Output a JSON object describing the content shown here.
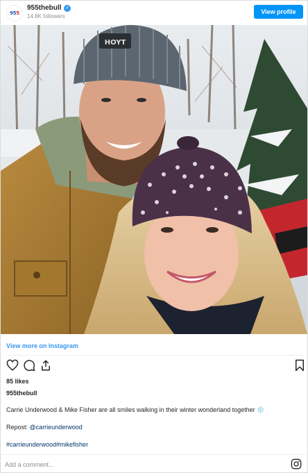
{
  "header": {
    "username": "955thebull",
    "followers": "14.8K followers",
    "view_profile_label": "View profile",
    "avatar_logo_main": "95",
    "avatar_logo_accent": "5"
  },
  "post": {
    "view_more_label": "View more on Instagram",
    "likes": "85 likes",
    "caption_user": "955thebull",
    "caption_text": "Carrie Underwood & Mike Fisher are all smiles walking in their winter wonderland together",
    "caption_emoji": "❄️",
    "repost_prefix": "Repost:",
    "repost_mention": "@carrieunderwood",
    "hashtags": [
      "#carrieunderwood",
      "#mikefisher"
    ]
  },
  "comment": {
    "placeholder": "Add a comment..."
  },
  "colors": {
    "accent": "#0095f6",
    "link": "#00376b",
    "verified": "#3897f0"
  },
  "icons": [
    "verified-icon",
    "heart-icon",
    "comment-icon",
    "share-icon",
    "bookmark-icon",
    "instagram-icon"
  ]
}
